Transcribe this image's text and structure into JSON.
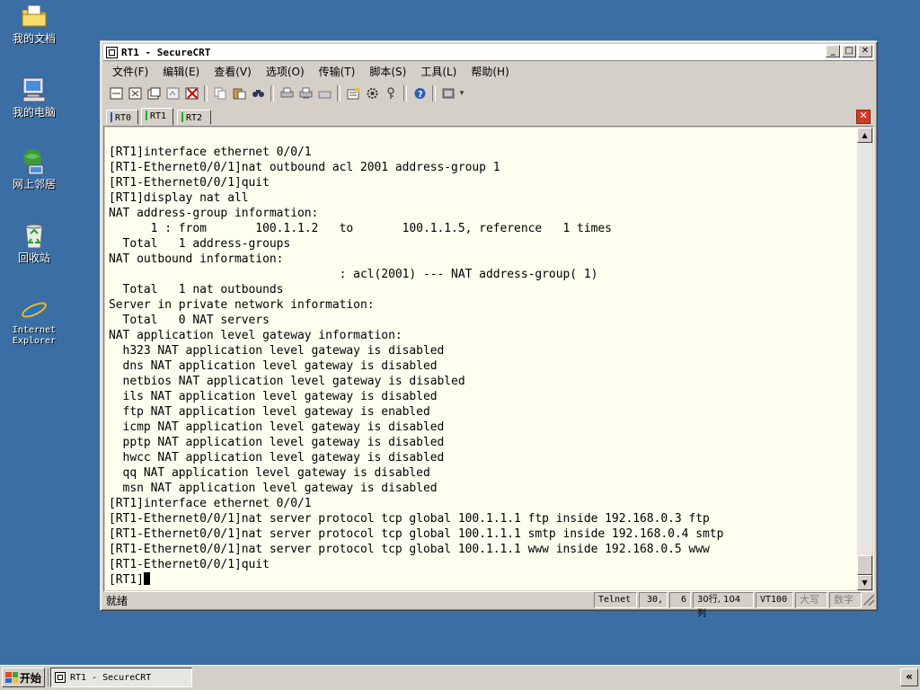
{
  "desktop": {
    "icons": [
      {
        "label": "我的文档",
        "icon": "my-documents-icon"
      },
      {
        "label": "我的电脑",
        "icon": "my-computer-icon"
      },
      {
        "label": "网上邻居",
        "icon": "network-places-icon"
      },
      {
        "label": "回收站",
        "icon": "recycle-bin-icon"
      },
      {
        "label": "Internet Explorer",
        "icon": "internet-explorer-icon"
      }
    ]
  },
  "window": {
    "title": "RT1 - SecureCRT",
    "controls": {
      "minimize": "_",
      "maximize": "□",
      "close": "✕"
    }
  },
  "menu": [
    "文件(F)",
    "编辑(E)",
    "查看(V)",
    "选项(O)",
    "传输(T)",
    "脚本(S)",
    "工具(L)",
    "帮助(H)"
  ],
  "toolbar": {
    "icons": [
      "connect-icon",
      "quick-connect-icon",
      "connect-tab-icon",
      "reconnect-icon",
      "disconnect-icon",
      "copy-icon",
      "paste-icon",
      "find-icon",
      "print-icon",
      "print-selection-icon",
      "printer-setup-icon",
      "session-options-icon",
      "global-options-icon",
      "keymap-icon",
      "help-icon",
      "sftp-icon"
    ]
  },
  "tabs": [
    {
      "label": "RT0",
      "color": "#2255cc",
      "active": false
    },
    {
      "label": "RT1",
      "color": "#22aa22",
      "active": true
    },
    {
      "label": "RT2",
      "color": "#22aa22",
      "active": false
    }
  ],
  "terminal": {
    "lines": [
      "[RT1]interface ethernet 0/0/1",
      "[RT1-Ethernet0/0/1]nat outbound acl 2001 address-group 1",
      "[RT1-Ethernet0/0/1]quit",
      "[RT1]display nat all",
      "NAT address-group information:",
      "      1 : from       100.1.1.2   to       100.1.1.5, reference   1 times",
      "  Total   1 address-groups",
      "NAT outbound information:",
      "                                 : acl(2001) --- NAT address-group( 1)",
      "  Total   1 nat outbounds",
      "Server in private network information:",
      "  Total   0 NAT servers",
      "NAT application level gateway information:",
      "  h323 NAT application level gateway is disabled",
      "  dns NAT application level gateway is disabled",
      "  netbios NAT application level gateway is disabled",
      "  ils NAT application level gateway is disabled",
      "  ftp NAT application level gateway is enabled",
      "  icmp NAT application level gateway is disabled",
      "  pptp NAT application level gateway is disabled",
      "  hwcc NAT application level gateway is disabled",
      "  qq NAT application level gateway is disabled",
      "  msn NAT application level gateway is disabled",
      "[RT1]interface ethernet 0/0/1",
      "[RT1-Ethernet0/0/1]nat server protocol tcp global 100.1.1.1 ftp inside 192.168.0.3 ftp",
      "[RT1-Ethernet0/0/1]nat server protocol tcp global 100.1.1.1 smtp inside 192.168.0.4 smtp",
      "[RT1-Ethernet0/0/1]nat server protocol tcp global 100.1.1.1 www inside 192.168.0.5 www",
      "[RT1-Ethernet0/0/1]quit"
    ],
    "prompt": "[RT1]"
  },
  "status": {
    "ready": "就绪",
    "protocol": "Telnet",
    "cursor_row": "30,",
    "cursor_col": "6",
    "dimensions": "30行, 104列",
    "emulation": "VT100",
    "caps": "大写",
    "num": "数字"
  },
  "taskbar": {
    "start": "开始",
    "task": "RT1 - SecureCRT",
    "tray": "«"
  }
}
